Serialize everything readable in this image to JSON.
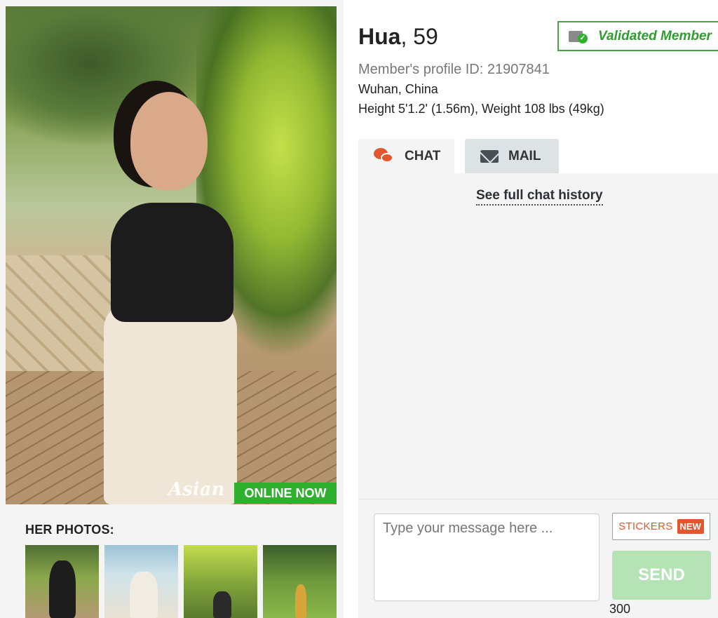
{
  "profile": {
    "name": "Hua",
    "age_text": ", 59",
    "validated_label": "Validated Member",
    "profile_id_text": "Member's profile ID: 21907841",
    "location": "Wuhan, China",
    "stats": "Height 5'1.2' (1.56m), Weight 108 lbs (49kg)"
  },
  "photo": {
    "online_badge": "ONLINE NOW",
    "watermark": "Asian"
  },
  "gallery": {
    "heading": "HER PHOTOS:"
  },
  "tabs": [
    {
      "label": "CHAT",
      "icon": "chat-bubbles-icon",
      "active": true
    },
    {
      "label": "MAIL",
      "icon": "envelope-icon",
      "active": false
    }
  ],
  "chat": {
    "history_link": "See full chat history",
    "placeholder": "Type your message here ...",
    "stickers_label": "STICKERS",
    "stickers_badge": "NEW",
    "send_label": "SEND",
    "char_count": "300"
  },
  "colors": {
    "online_green": "#2fb12f",
    "validated_green": "#2e9e2e",
    "accent_orange": "#e4572e",
    "send_disabled": "#b6e3b6"
  }
}
